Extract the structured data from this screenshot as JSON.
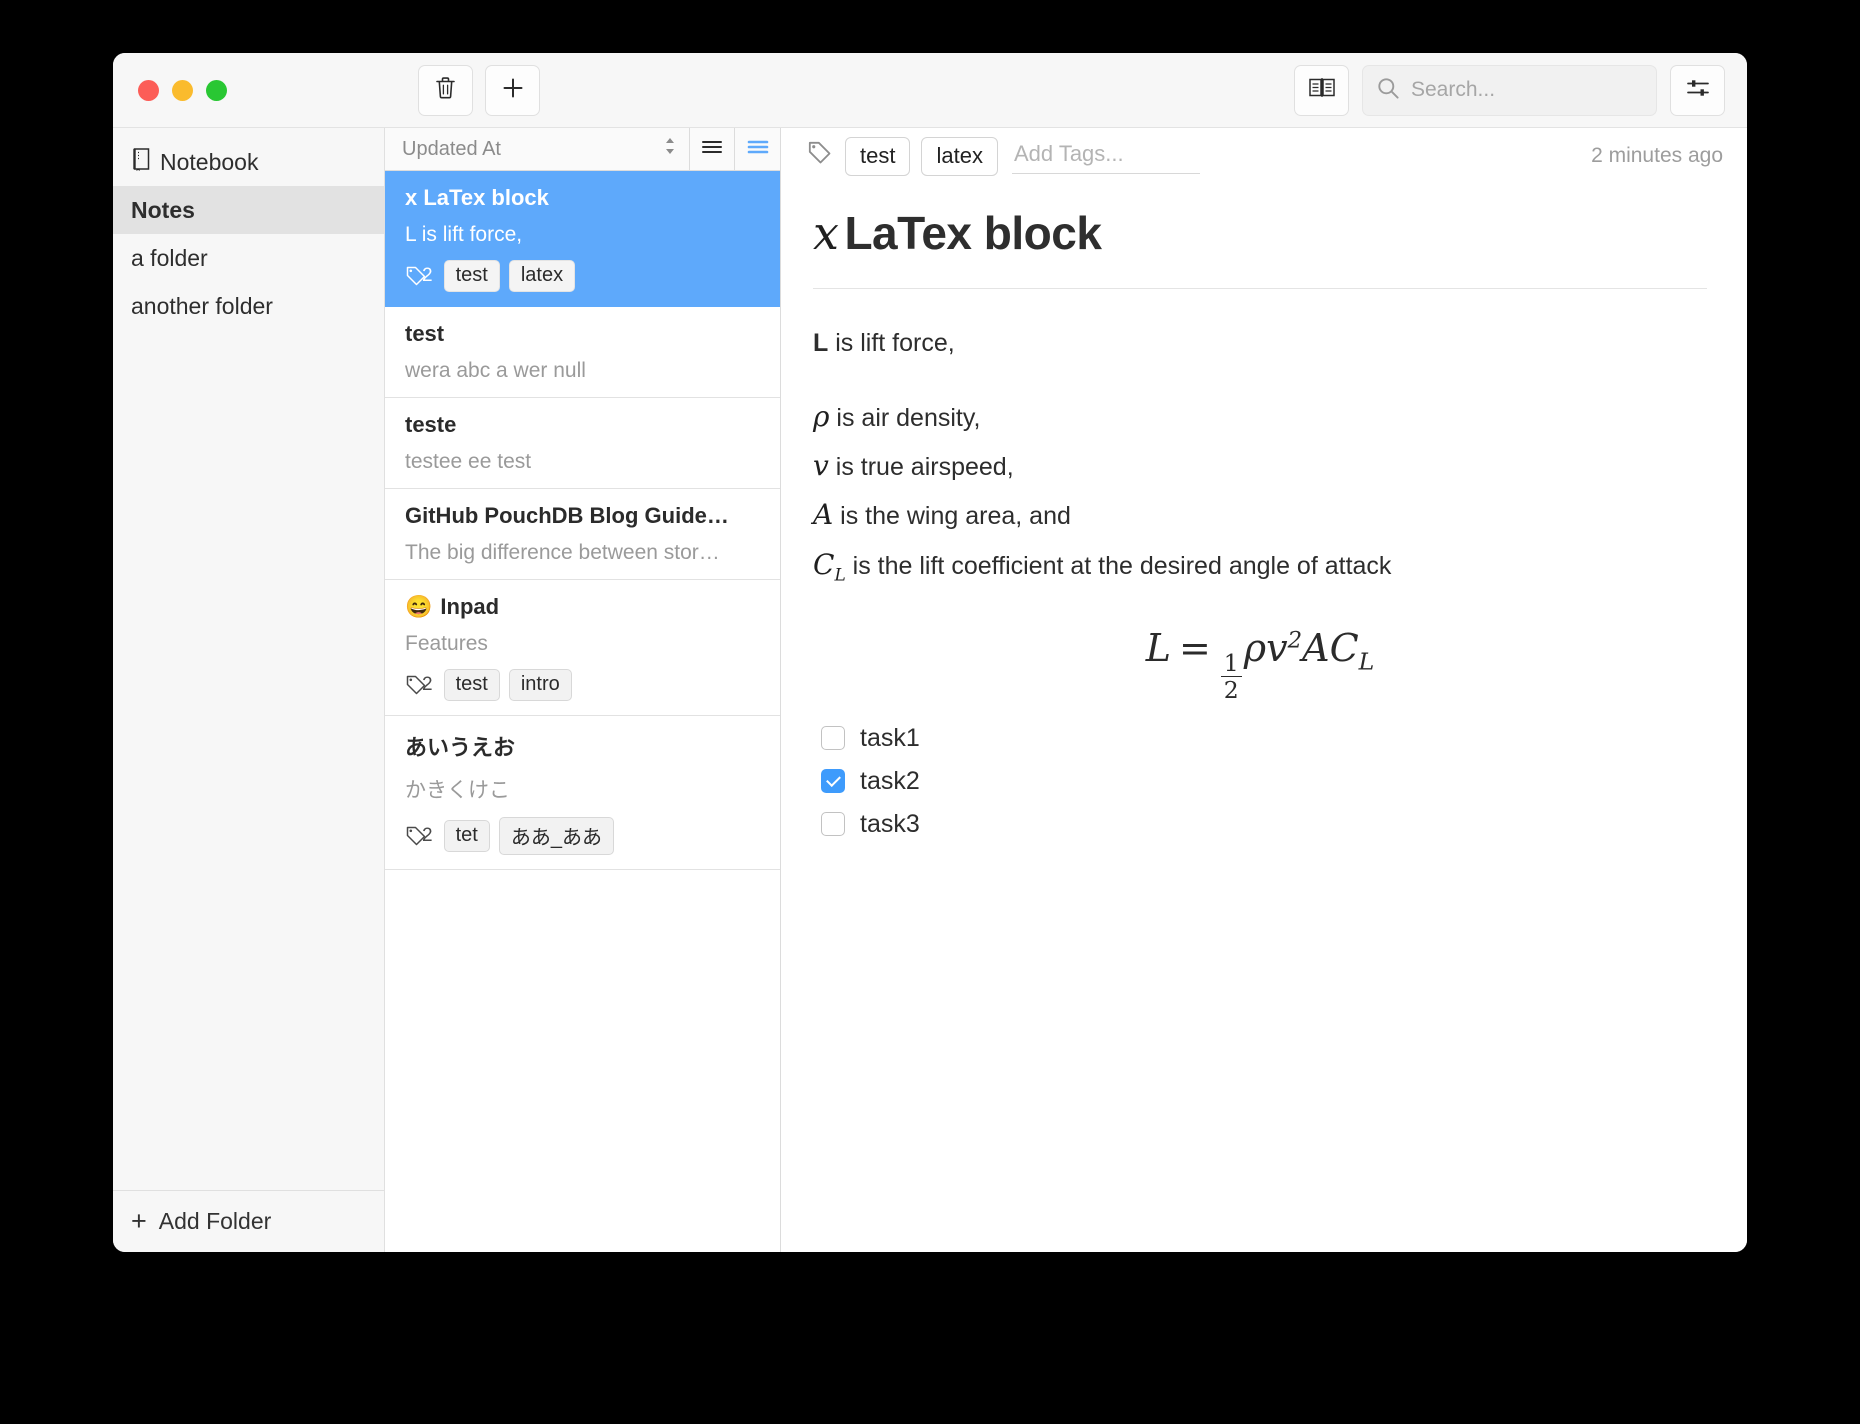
{
  "window": {
    "traffic_lights": [
      "close",
      "minimize",
      "zoom"
    ],
    "colors": {
      "accent_blue": "#5ea9fb",
      "checkbox_blue": "#3e9bfc",
      "close_red": "#fc5d57",
      "minimize_yellow": "#fabb2d",
      "zoom_green": "#29c733"
    }
  },
  "toolbar": {
    "delete_icon": "trash-icon",
    "new_note_icon": "plus-icon",
    "preview_icon": "book-icon",
    "settings_icon": "sliders-icon",
    "search": {
      "icon": "search-icon",
      "placeholder": "Search...",
      "value": ""
    }
  },
  "sidebar": {
    "items": [
      {
        "label": "Notebook",
        "icon": "notebook-icon",
        "active": false
      },
      {
        "label": "Notes",
        "icon": "",
        "active": true
      },
      {
        "label": "a folder",
        "icon": "",
        "active": false
      },
      {
        "label": "another folder",
        "icon": "",
        "active": false
      }
    ],
    "add_folder": {
      "label": "Add Folder",
      "icon": "plus-icon"
    }
  },
  "notelist": {
    "sort": {
      "label": "Updated At",
      "icon": "sort-chevrons-icon"
    },
    "view_compact_icon": "list-compact-icon",
    "view_expanded_icon": "list-expanded-icon",
    "items": [
      {
        "title": "x LaTex block",
        "emoji": "",
        "preview": "L is lift force,",
        "tag_count": "2",
        "tags": [
          "test",
          "latex"
        ],
        "selected": true
      },
      {
        "title": "test",
        "emoji": "",
        "preview": "wera abc a wer null",
        "tag_count": "",
        "tags": [],
        "selected": false
      },
      {
        "title": "teste",
        "emoji": "",
        "preview": "testee ee test",
        "tag_count": "",
        "tags": [],
        "selected": false
      },
      {
        "title": "GitHub PouchDB Blog Guide…",
        "emoji": "",
        "preview": "The big difference between stor…",
        "tag_count": "",
        "tags": [],
        "selected": false
      },
      {
        "title": "Inpad",
        "emoji": "😄",
        "preview": "Features",
        "tag_count": "2",
        "tags": [
          "test",
          "intro"
        ],
        "selected": false
      },
      {
        "title": "あいうえお",
        "emoji": "",
        "preview": "かきくけこ",
        "tag_count": "2",
        "tags": [
          "tet",
          "ああ_ああ"
        ],
        "selected": false
      }
    ]
  },
  "editor": {
    "tag_icon": "tag-icon",
    "tags": [
      "test",
      "latex"
    ],
    "add_tags_placeholder": "Add Tags...",
    "add_tags_value": "",
    "timestamp": "2 minutes ago",
    "heading_math": "x",
    "heading_text": "LaTex block",
    "paragraphs": [
      {
        "math": "L",
        "math_style": "bold-sans",
        "text": " is lift force,"
      },
      {
        "math": "ρ",
        "math_style": "serif-italic",
        "text": " is air density,"
      },
      {
        "math": "v",
        "math_style": "serif-italic",
        "text": " is true airspeed,"
      },
      {
        "math": "A",
        "math_style": "serif-italic",
        "text": " is the wing area, and"
      },
      {
        "math": "C",
        "math_sub": "L",
        "math_style": "serif-italic",
        "text": " is the lift coefficient at the desired angle of attack"
      }
    ],
    "equation": {
      "lhs": "L",
      "operator": "=",
      "fraction_numerator": "1",
      "fraction_denominator": "2",
      "rhs_rho": "ρ",
      "rhs_v": "v",
      "rhs_exponent": "2",
      "rhs_A": "A",
      "rhs_C": "C",
      "rhs_C_sub": "L",
      "plain": "L = 1/2 ρv²AC_L"
    },
    "tasks": [
      {
        "label": "task1",
        "checked": false
      },
      {
        "label": "task2",
        "checked": true
      },
      {
        "label": "task3",
        "checked": false
      }
    ]
  }
}
